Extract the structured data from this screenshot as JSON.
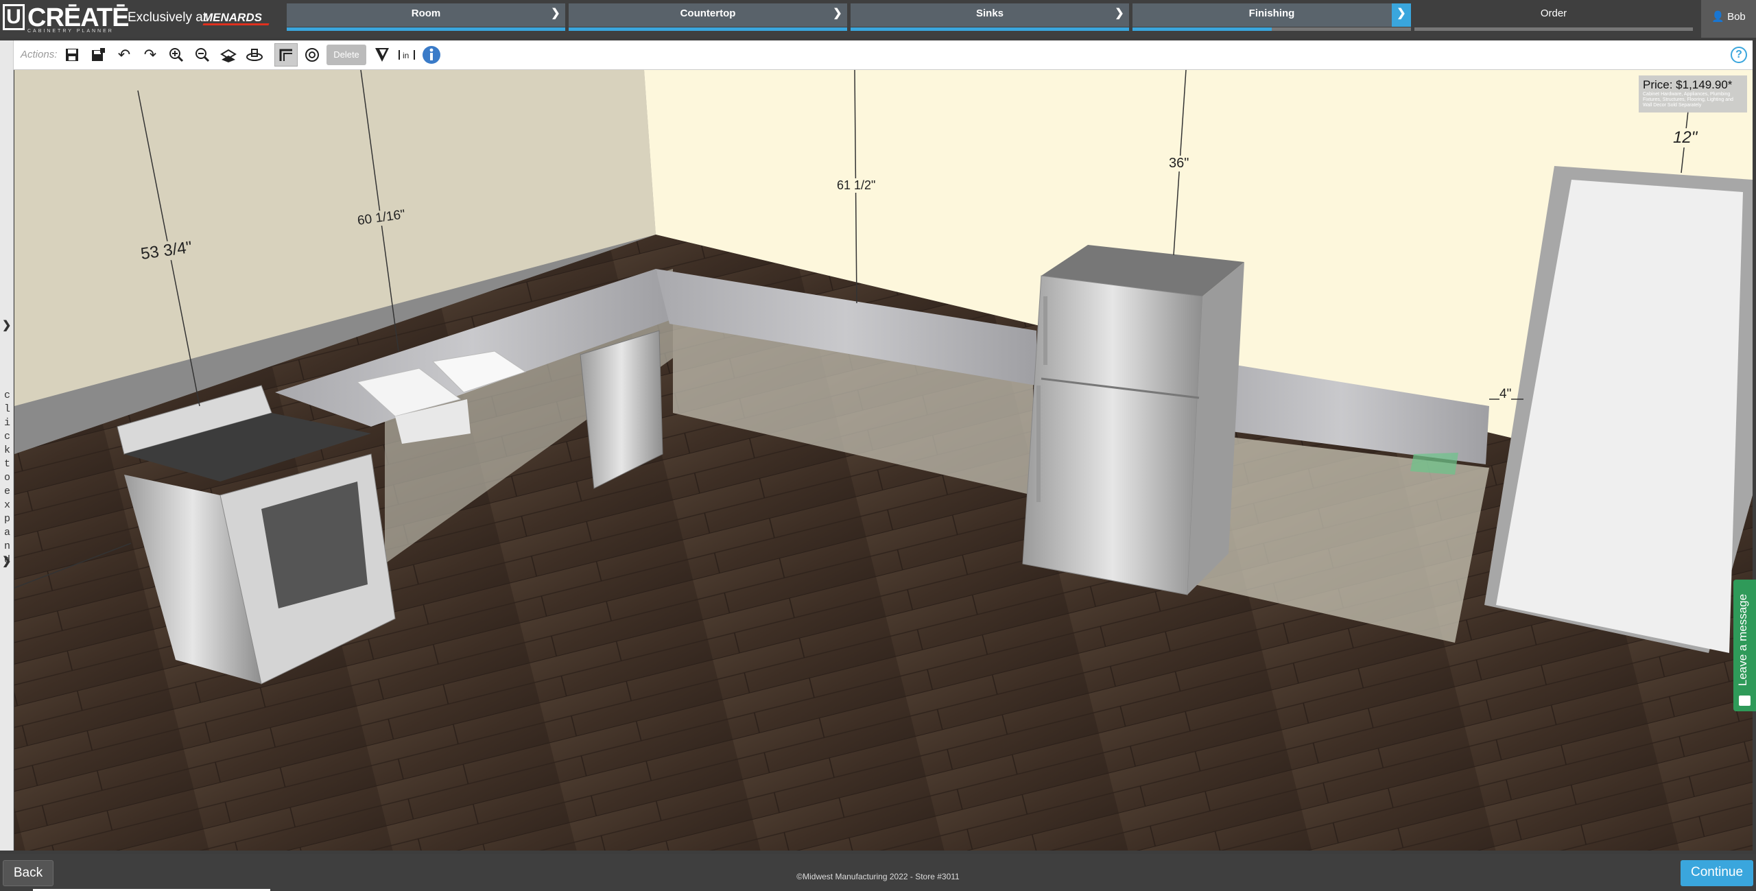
{
  "header": {
    "logo_letter": "U",
    "logo_text": "CRĒATĒ",
    "logo_sub": "CABINETRY PLANNER",
    "exclusive_text": "Exclusively at",
    "brand": "MENARDS",
    "steps": [
      {
        "label": "Room",
        "state": "completed"
      },
      {
        "label": "Countertop",
        "state": "completed"
      },
      {
        "label": "Sinks",
        "state": "completed"
      },
      {
        "label": "Finishing",
        "state": "active",
        "progress": 0.5
      },
      {
        "label": "Order",
        "state": "pending"
      }
    ],
    "user": "Bob"
  },
  "actions": {
    "label": "Actions:",
    "delete_label": "Delete",
    "tools": [
      "save-icon",
      "save-as-icon",
      "undo-icon",
      "redo-icon",
      "zoom-in-icon",
      "zoom-out-icon",
      "floor-view-icon",
      "3d-view-icon",
      "wall-view-icon",
      "rotate-view-icon",
      "delete",
      "finish-swatch-icon",
      "measure-icon",
      "info-icon"
    ],
    "help_icon": "question-icon"
  },
  "sidebar": {
    "expand_text": "click to expand"
  },
  "scene": {
    "price": "Price: $1,149.90*",
    "price_note": "Cabinet Hardware, Appliances, Plumbing Fixtures, Structures, Flooring, Lighting and Wall Decor Sold Separately",
    "dimensions": [
      "53 3/4\"",
      "60 1/16\"",
      "61 1/2\"",
      "36\"",
      "12\"",
      "4\""
    ]
  },
  "chat": {
    "label": "Leave a message"
  },
  "footer": {
    "back_label": "Back",
    "copyright": "©Midwest Manufacturing 2022 - Store #3011",
    "continue_label": "Continue"
  },
  "colors": {
    "accent": "#3aa6dd",
    "bar": "#3f3f3f",
    "step": "#59626a",
    "chat": "#2f9a59"
  }
}
